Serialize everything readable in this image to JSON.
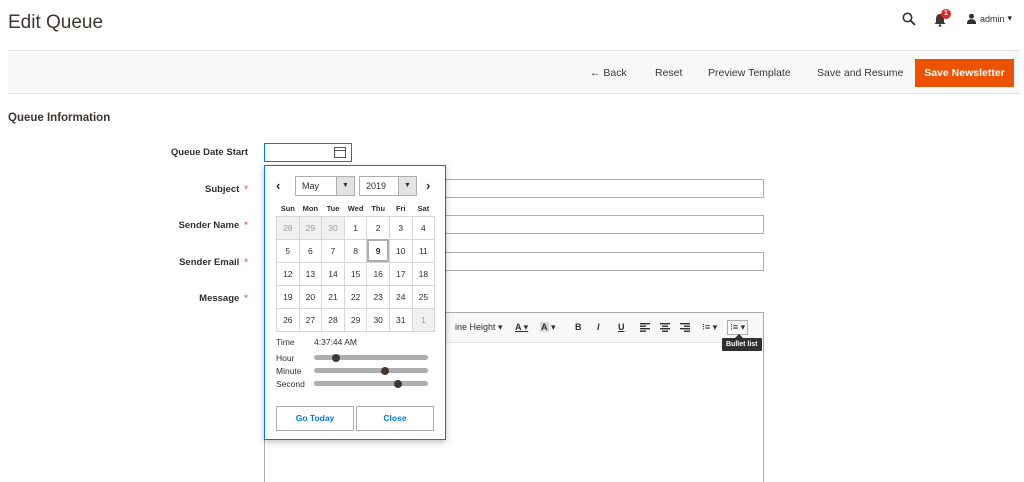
{
  "header": {
    "title": "Edit Queue",
    "notification_count": "1",
    "user_label": "admin"
  },
  "actions": {
    "back": "← Back",
    "reset": "Reset",
    "preview": "Preview Template",
    "save_resume": "Save and Resume",
    "save_newsletter": "Save Newsletter"
  },
  "section": {
    "title": "Queue Information"
  },
  "form": {
    "date_start_label": "Queue Date Start",
    "subject_label": "Subject",
    "sender_name_label": "Sender Name",
    "sender_email_label": "Sender Email",
    "message_label": "Message",
    "required_mark": "*"
  },
  "editor": {
    "line_height": "ine Height",
    "font_color": "A",
    "bg_color": "A",
    "bold": "B",
    "italic": "I",
    "underline": "U",
    "tooltip": "Bullet list"
  },
  "datepicker": {
    "month": "May",
    "year": "2019",
    "weekdays": [
      "Sun",
      "Mon",
      "Tue",
      "Wed",
      "Thu",
      "Fri",
      "Sat"
    ],
    "weeks": [
      [
        "28",
        "29",
        "30",
        "1",
        "2",
        "3",
        "4"
      ],
      [
        "5",
        "6",
        "7",
        "8",
        "9",
        "10",
        "11"
      ],
      [
        "12",
        "13",
        "14",
        "15",
        "16",
        "17",
        "18"
      ],
      [
        "19",
        "20",
        "21",
        "22",
        "23",
        "24",
        "25"
      ],
      [
        "26",
        "27",
        "28",
        "29",
        "30",
        "31",
        "1"
      ]
    ],
    "time_label": "Time",
    "time_value": "4:37:44 AM",
    "hour_label": "Hour",
    "minute_label": "Minute",
    "second_label": "Second",
    "hour_fraction": 0.17,
    "minute_fraction": 0.63,
    "second_fraction": 0.75,
    "go_today": "Go Today",
    "close": "Close"
  },
  "colors": {
    "accent": "#eb5202",
    "focus": "#007bdb",
    "required": "#e22626"
  }
}
